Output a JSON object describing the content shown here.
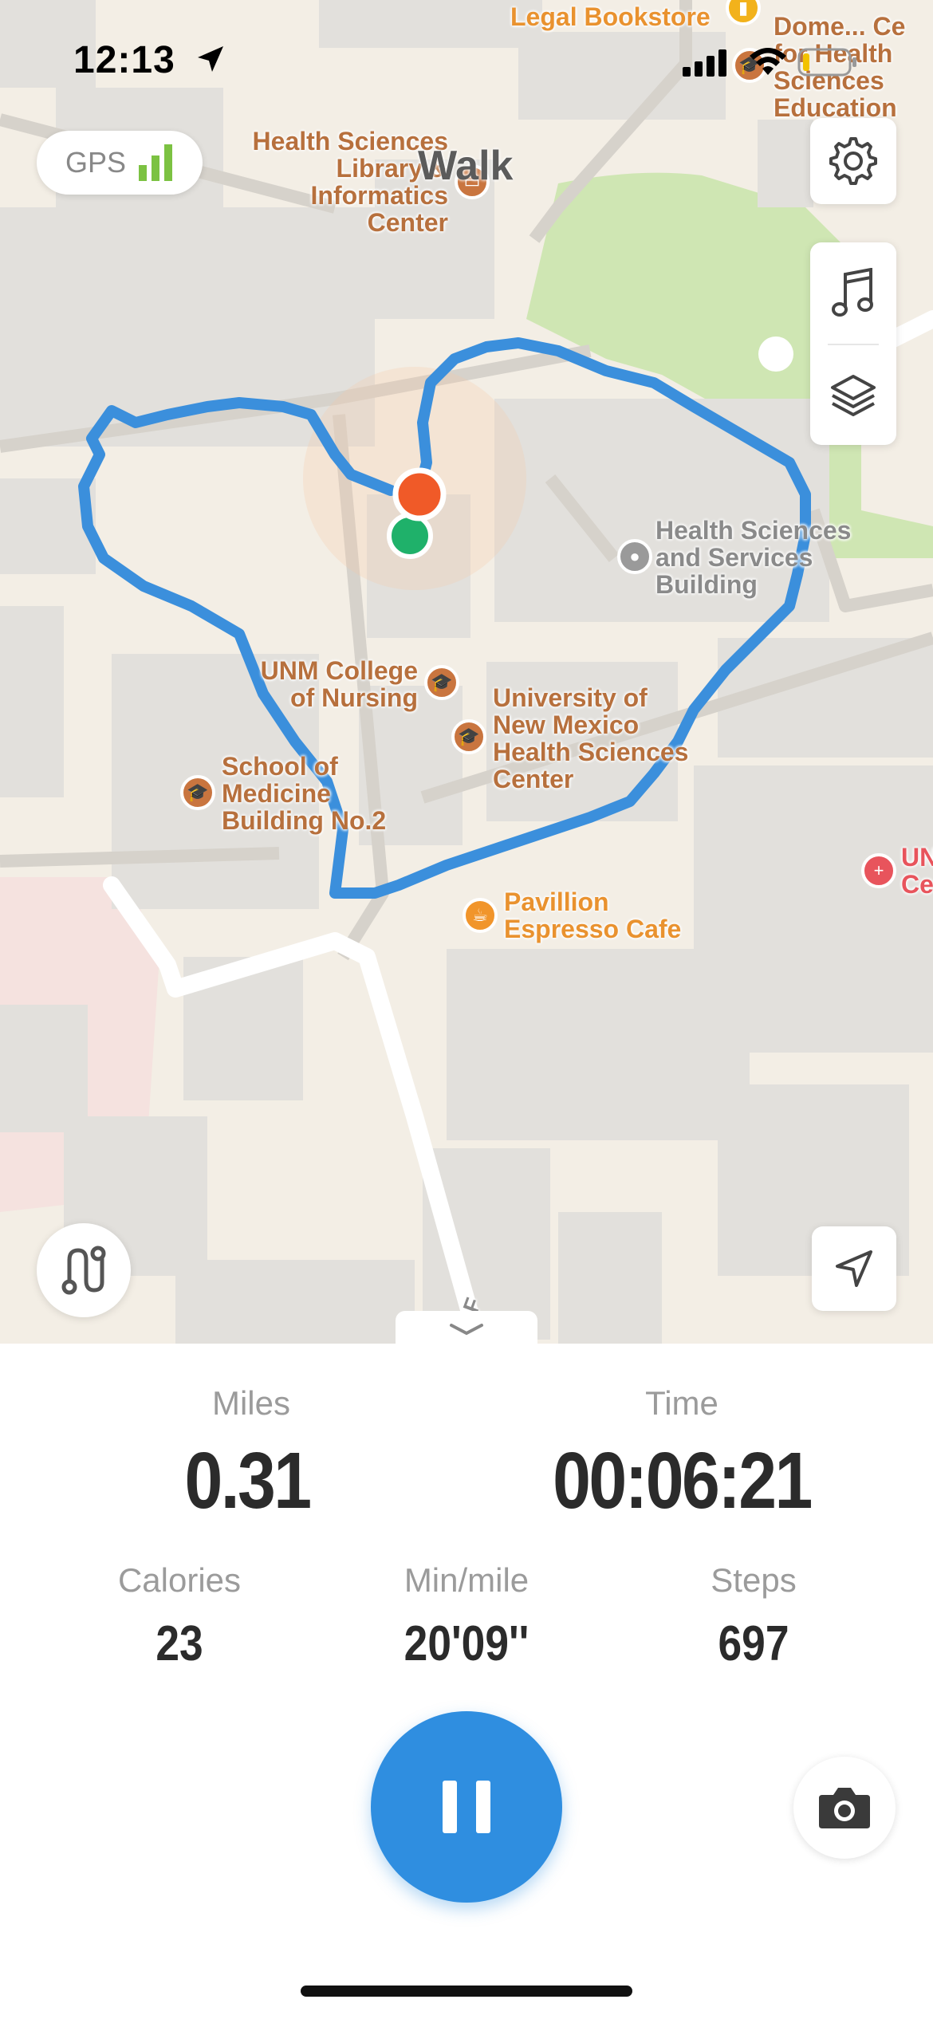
{
  "status_bar": {
    "time": "12:13",
    "icons": [
      "location-arrow-icon",
      "cellular-signal-icon",
      "wifi-icon",
      "battery-icon"
    ]
  },
  "map": {
    "gps": {
      "label": "GPS",
      "signal_color": "#7cc242"
    },
    "activity_label": "Walk",
    "route_color": "#3b8fdc",
    "start_marker_color": "#1fb16a",
    "current_marker_color": "#f05a28",
    "pois": [
      {
        "name": "Legal Bookstore"
      },
      {
        "name": "Dome... Ce\nfor Health\nSciences\nEducation"
      },
      {
        "name": "Health Sciences\nLibrary &\nInformatics\nCenter"
      },
      {
        "name": "Health Sciences\nand Services\nBuilding"
      },
      {
        "name": "UNM College\nof Nursing"
      },
      {
        "name": "University of\nNew Mexico\nHealth Sciences\nCenter"
      },
      {
        "name": "School of\nMedicine\nBuilding No.2"
      },
      {
        "name": "Pavillion\nEspresso Cafe"
      },
      {
        "name": "UN\nCe"
      }
    ],
    "road_letter": "F"
  },
  "stats": {
    "distance": {
      "label": "Miles",
      "value": "0.31"
    },
    "time": {
      "label": "Time",
      "value": "00:06:21"
    },
    "calories": {
      "label": "Calories",
      "value": "23"
    },
    "pace": {
      "label": "Min/mile",
      "value": "20'09''"
    },
    "steps": {
      "label": "Steps",
      "value": "697"
    }
  },
  "controls": {
    "primary_color": "#2f8ee0",
    "buttons": [
      "pause-icon",
      "camera-icon",
      "route-icon",
      "recenter-icon",
      "settings-icon",
      "music-icon",
      "layers-icon"
    ]
  }
}
